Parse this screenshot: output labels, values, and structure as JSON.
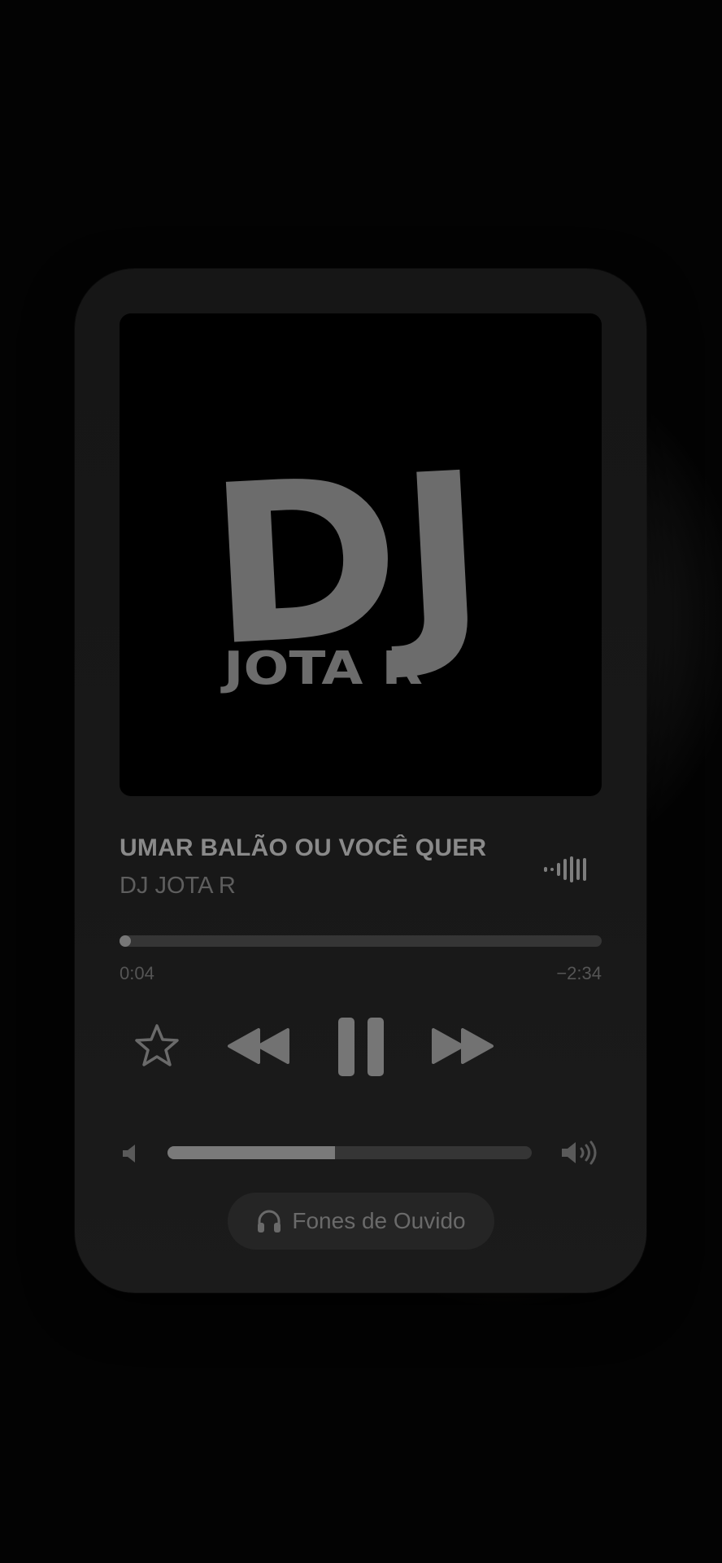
{
  "now_playing": {
    "artwork": {
      "logo_big_text": "DJ",
      "logo_small_text": "JOTA R"
    },
    "track_title": "UMAR BALÃO OU VOCÊ QUER",
    "artist": "DJ JOTA R",
    "progress_fraction": 0.021,
    "time_elapsed": "0:04",
    "time_remaining": "−2:34",
    "volume_fraction": 0.46,
    "output_label": "Fones de Ouvido"
  },
  "icons": {
    "favorite": "star-icon",
    "previous": "rewind-icon",
    "play_state": "pause-icon",
    "next": "fast-forward-icon",
    "volume_low": "speaker-low-icon",
    "volume_high": "speaker-high-icon",
    "output": "headphones-icon",
    "waveform": "audio-waveform-icon"
  },
  "colors": {
    "background": "#030303",
    "card": "#181818",
    "primary_text": "#8a8a8a",
    "secondary_text": "#5e5e5e",
    "track": "#353535",
    "fill": "#777777"
  }
}
